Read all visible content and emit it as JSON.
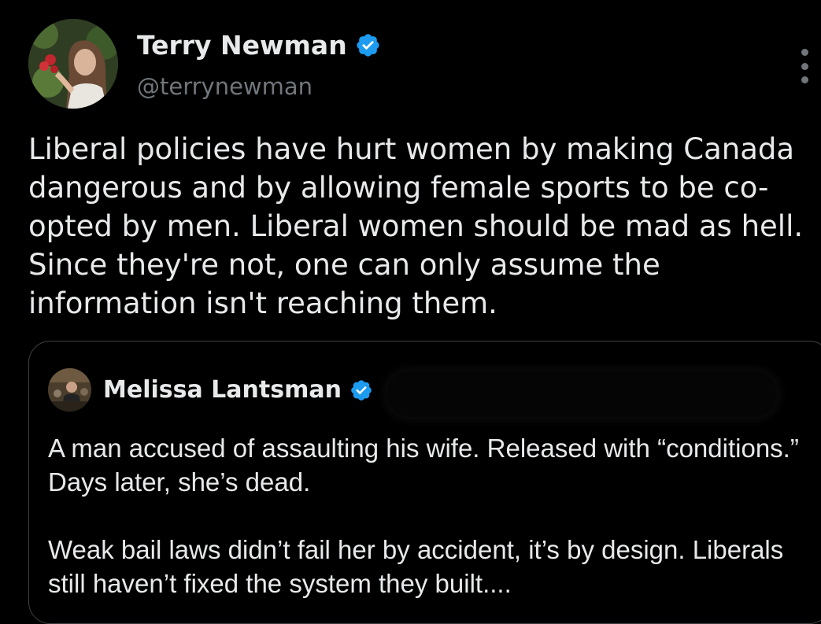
{
  "tweet": {
    "author_name": "Terry Newman",
    "author_handle": "@terrynewman",
    "text": "Liberal policies have hurt women by making Canada dangerous and by allowing female sports to be co-opted by men. Liberal women should be mad as hell. Since they're not, one can only assume the information isn't reaching them."
  },
  "quoted_tweet": {
    "author_name": "Melissa Lantsman",
    "text": "A man accused of assaulting his wife. Released with “conditions.” Days later, she’s dead.\n\nWeak bail laws didn’t fail her by accident, it’s by design. Liberals still haven’t fixed the system they built...."
  },
  "icons": {
    "verified": "verified-badge-icon",
    "more": "more-options-icon"
  },
  "colors": {
    "background": "#000000",
    "text_primary": "#e7e9ea",
    "text_secondary": "#71767b",
    "verified_blue": "#1d9bf0",
    "border": "#3e4144"
  }
}
